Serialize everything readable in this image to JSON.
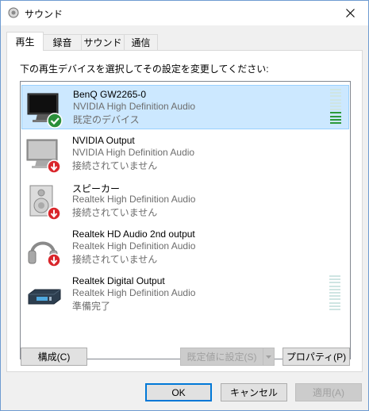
{
  "window": {
    "title": "サウンド"
  },
  "tabs": [
    {
      "label": "再生",
      "active": true
    },
    {
      "label": "録音",
      "active": false
    },
    {
      "label": "サウンド",
      "active": false
    },
    {
      "label": "通信",
      "active": false
    }
  ],
  "instruction": "下の再生デバイスを選択してその設定を変更してください:",
  "devices": [
    {
      "name": "BenQ GW2265-0",
      "driver": "NVIDIA High Definition Audio",
      "status": "既定のデバイス",
      "icon": "monitor-icon",
      "badge": "default-check",
      "meter_level": 0.35
    },
    {
      "name": "NVIDIA Output",
      "driver": "NVIDIA High Definition Audio",
      "status": "接続されていません",
      "icon": "monitor-icon",
      "badge": "disconnected"
    },
    {
      "name": "スピーカー",
      "driver": "Realtek High Definition Audio",
      "status": "接続されていません",
      "icon": "speaker-icon",
      "badge": "disconnected"
    },
    {
      "name": "Realtek HD Audio 2nd output",
      "driver": "Realtek High Definition Audio",
      "status": "接続されていません",
      "icon": "headphones-icon",
      "badge": "disconnected"
    },
    {
      "name": "Realtek Digital Output",
      "driver": "Realtek High Definition Audio",
      "status": "準備完了",
      "icon": "digital-output-icon",
      "badge": "none",
      "meter_level": 0
    }
  ],
  "buttons": {
    "configure": "構成(C)",
    "set_default": "既定値に設定(S)",
    "properties": "プロパティ(P)",
    "ok": "OK",
    "cancel": "キャンセル",
    "apply": "適用(A)"
  },
  "colors": {
    "selection": "#cce8ff",
    "selection_border": "#99d1ff",
    "meter_active": "#2c9a39",
    "meter_idle": "#cfe5e3",
    "accent": "#0078d7"
  }
}
